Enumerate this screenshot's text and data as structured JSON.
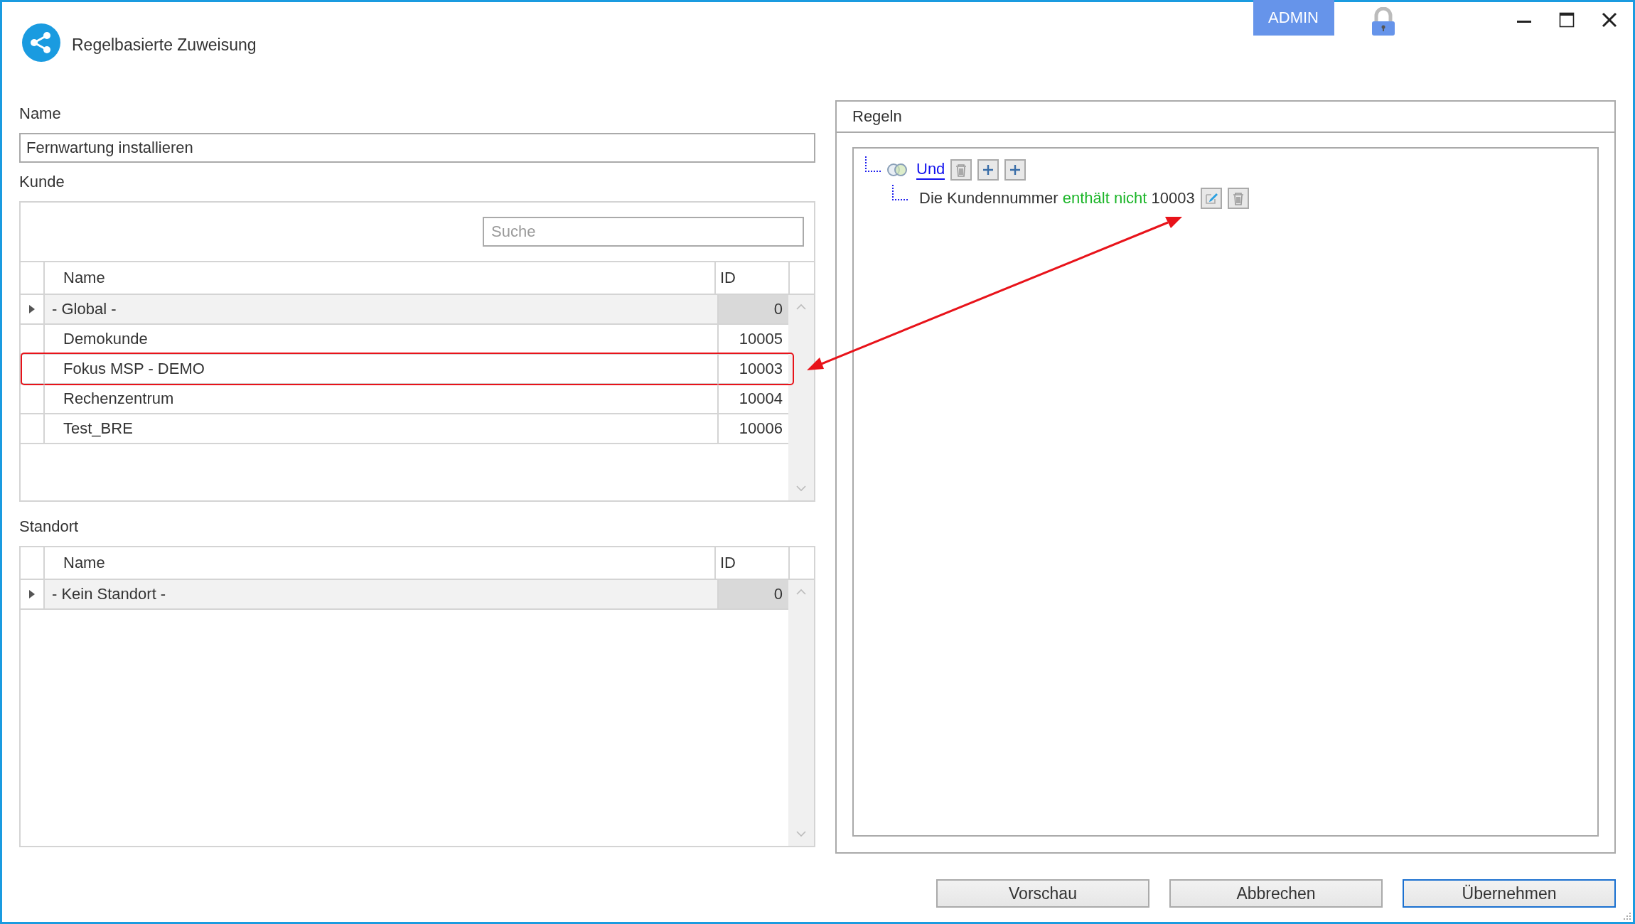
{
  "window": {
    "title": "Regelbasierte Zuweisung",
    "user_badge": "ADMIN",
    "locked": true
  },
  "name_field": {
    "label": "Name",
    "value": "Fernwartung installieren"
  },
  "customer": {
    "label": "Kunde",
    "search": {
      "placeholder": "Suche"
    },
    "columns": [
      "Name",
      "ID"
    ],
    "rows": [
      {
        "name": "- Global -",
        "id": "0",
        "selected": true,
        "highlighted": false
      },
      {
        "name": "Demokunde",
        "id": "10005",
        "selected": false,
        "highlighted": false
      },
      {
        "name": "Fokus MSP - DEMO",
        "id": "10003",
        "selected": false,
        "highlighted": true
      },
      {
        "name": "Rechenzentrum",
        "id": "10004",
        "selected": false,
        "highlighted": false
      },
      {
        "name": "Test_BRE",
        "id": "10006",
        "selected": false,
        "highlighted": false
      }
    ]
  },
  "location": {
    "label": "Standort",
    "columns": [
      "Name",
      "ID"
    ],
    "rows": [
      {
        "name": "- Kein Standort -",
        "id": "0",
        "selected": true,
        "highlighted": false
      }
    ]
  },
  "rules": {
    "title": "Regeln",
    "tree": [
      {
        "kind": "group",
        "label": "Und",
        "children": [
          {
            "kind": "condition",
            "field": "Die Kundennummer",
            "operator": "enthält nicht",
            "value": "10003"
          }
        ]
      }
    ]
  },
  "buttons": [
    {
      "label": "Vorschau",
      "default": false
    },
    {
      "label": "Abbrechen",
      "default": false
    },
    {
      "label": "Übernehmen",
      "default": true
    }
  ]
}
